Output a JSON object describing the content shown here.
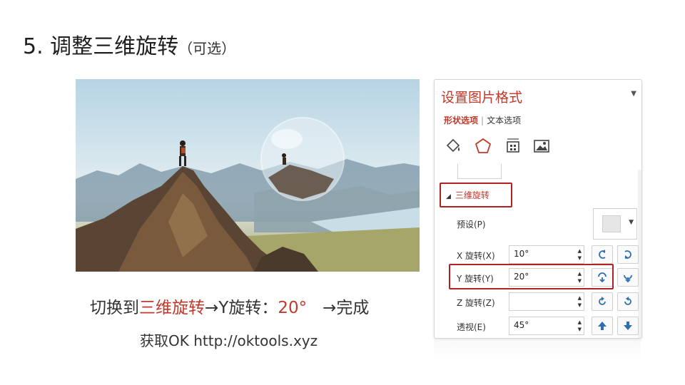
{
  "slide": {
    "title_main": "5. 调整三维旋转",
    "title_sub": "（可选）",
    "caption_part1": "切换到",
    "caption_red1": "三维旋转",
    "caption_part2": "→Y旋转：",
    "caption_red2": "20°",
    "caption_part3": "→完成",
    "source": "获取OK  http://oktools.xyz"
  },
  "panel": {
    "title": "设置图片格式",
    "collapse_arrow": "▼",
    "tab_shape": "形状选项",
    "tab_text": "文本选项",
    "icons": [
      "fill-bucket-icon",
      "pentagon-effects-icon",
      "size-layout-icon",
      "picture-icon"
    ],
    "section_label": "三维旋转",
    "preset_label": "预设(P)",
    "rows": [
      {
        "label": "X 旋转(X)",
        "value": "10°"
      },
      {
        "label": "Y 旋转(Y)",
        "value": "20°"
      },
      {
        "label": "Z 旋转(Z)",
        "value": ""
      },
      {
        "label": "透视(E)",
        "value": "45°"
      }
    ]
  },
  "colors": {
    "accent": "#c0392b",
    "highlight_border": "#b22222"
  }
}
